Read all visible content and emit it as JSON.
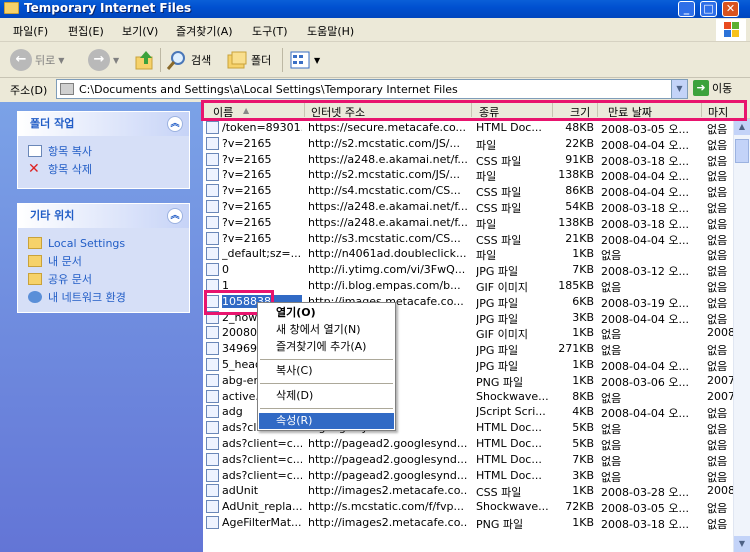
{
  "window": {
    "title": "Temporary Internet Files"
  },
  "menu": [
    "파일(F)",
    "편집(E)",
    "보기(V)",
    "즐겨찾기(A)",
    "도구(T)",
    "도움말(H)"
  ],
  "toolbar": {
    "back": "뒤로",
    "search": "검색",
    "folders": "폴더"
  },
  "address": {
    "label": "주소(D)",
    "path": "C:\\Documents and Settings\\a\\Local Settings\\Temporary Internet Files",
    "go": "이동"
  },
  "left": {
    "tasks": {
      "title": "폴더 작업",
      "items": [
        "항목 복사",
        "항목 삭제"
      ]
    },
    "places": {
      "title": "기타 위치",
      "items": [
        "Local Settings",
        "내 문서",
        "공유 문서",
        "내 네트워크 환경"
      ]
    }
  },
  "columns": [
    "이름",
    "인터넷 주소",
    "종류",
    "크기",
    "만료 날짜",
    "마지"
  ],
  "rows": [
    [
      "/token=89301...",
      "https://secure.metacafe.co...",
      "HTML Doc...",
      "48KB",
      "2008-03-05 오...",
      "없음"
    ],
    [
      "?v=2165",
      "http://s2.mcstatic.com/JS/...",
      "파일",
      "22KB",
      "2008-04-04 오...",
      "없음"
    ],
    [
      "?v=2165",
      "https://a248.e.akamai.net/f...",
      "CSS 파일",
      "91KB",
      "2008-03-18 오...",
      "없음"
    ],
    [
      "?v=2165",
      "http://s2.mcstatic.com/JS/...",
      "파일",
      "138KB",
      "2008-04-04 오...",
      "없음"
    ],
    [
      "?v=2165",
      "http://s4.mcstatic.com/CS...",
      "CSS 파일",
      "86KB",
      "2008-04-04 오...",
      "없음"
    ],
    [
      "?v=2165",
      "https://a248.e.akamai.net/f...",
      "CSS 파일",
      "54KB",
      "2008-03-18 오...",
      "없음"
    ],
    [
      "?v=2165",
      "https://a248.e.akamai.net/f...",
      "파일",
      "138KB",
      "2008-03-18 오...",
      "없음"
    ],
    [
      "?v=2165",
      "http://s3.mcstatic.com/CS...",
      "CSS 파일",
      "21KB",
      "2008-04-04 오...",
      "없음"
    ],
    [
      "_default;sz=...",
      "http://n4061ad.doubleclick...",
      "파일",
      "1KB",
      "없음",
      "없음"
    ],
    [
      "0",
      "http://i.ytimg.com/vi/3FwQ...",
      "JPG 파일",
      "7KB",
      "2008-03-12 오...",
      "없음"
    ],
    [
      "1",
      "http://i.blog.empas.com/b...",
      "GIF 이미지",
      "185KB",
      "없음",
      "없음"
    ],
    [
      "1058838",
      "http://images.metacafe.co...",
      "JPG 파일",
      "6KB",
      "2008-03-19 오...",
      "없음"
    ],
    [
      "2_now...",
      "...c.com/thu...",
      "JPG 파일",
      "3KB",
      "2008-04-04 오...",
      "없음"
    ],
    [
      "200802...",
      "...s.com/blog/...",
      "GIF 이미지",
      "1KB",
      "없음",
      "2008"
    ],
    [
      "349691...",
      "...as.com/in...",
      "JPG 파일",
      "271KB",
      "없음",
      "없음"
    ],
    [
      "5_head...",
      "...c.com/thu...",
      "JPG 파일",
      "1KB",
      "2008-04-04 오...",
      "없음"
    ],
    [
      "abg-en...",
      "...googlesynd...",
      "PNG 파일",
      "1KB",
      "2008-03-06 오...",
      "2007"
    ],
    [
      "active...",
      "...ube.com/...",
      "Shockwave...",
      "8KB",
      "없음",
      "2007"
    ],
    [
      "adg",
      "...com/...",
      "JScript Scri...",
      "4KB",
      "2008-04-04 오...",
      "없음"
    ],
    [
      "ads?client=c...",
      "...googlesynd...",
      "HTML Doc...",
      "5KB",
      "없음",
      "없음"
    ],
    [
      "ads?client=c...",
      "http://pagead2.googlesynd...",
      "HTML Doc...",
      "5KB",
      "없음",
      "없음"
    ],
    [
      "ads?client=c...",
      "http://pagead2.googlesynd...",
      "HTML Doc...",
      "7KB",
      "없음",
      "없음"
    ],
    [
      "ads?client=c...",
      "http://pagead2.googlesynd...",
      "HTML Doc...",
      "3KB",
      "없음",
      "없음"
    ],
    [
      "adUnit",
      "http://images2.metacafe.co...",
      "CSS 파일",
      "1KB",
      "2008-03-28 오...",
      "2008"
    ],
    [
      "AdUnit_repla...",
      "http://s.mcstatic.com/f/fvp...",
      "Shockwave...",
      "72KB",
      "2008-03-05 오...",
      "없음"
    ],
    [
      "AgeFilterMat...",
      "http://images2.metacafe.co...",
      "PNG 파일",
      "1KB",
      "2008-03-18 오...",
      "없음"
    ]
  ],
  "context_menu": [
    "열기(O)",
    "새 창에서 열기(N)",
    "즐겨찾기에 추가(A)",
    "복사(C)",
    "삭제(D)",
    "속성(R)"
  ]
}
